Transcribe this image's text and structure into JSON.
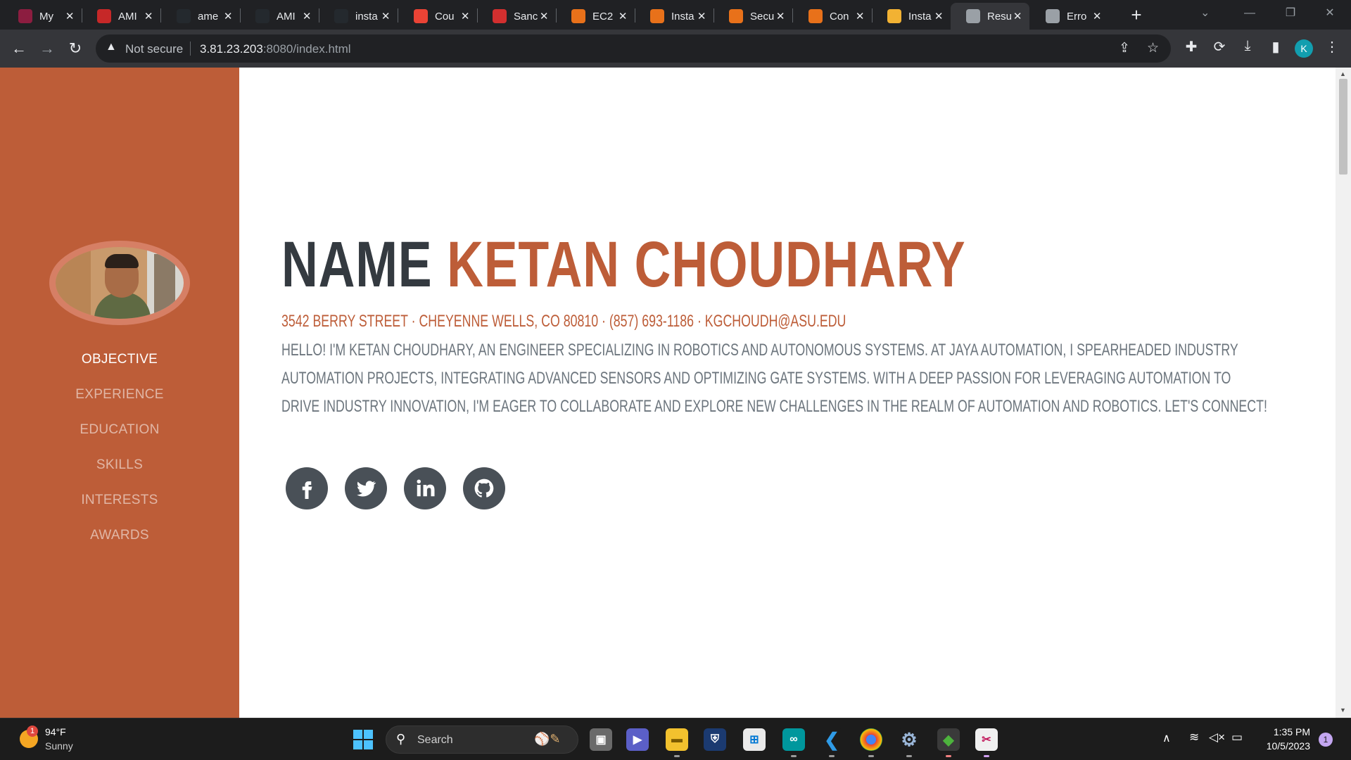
{
  "browser": {
    "tabs": [
      {
        "title": "My",
        "favicon": "asu-icon",
        "color": "#8c1d40"
      },
      {
        "title": "AMI",
        "favicon": "ami-icon",
        "color": "#c62828"
      },
      {
        "title": "ame",
        "favicon": "github-icon",
        "color": "#24292e"
      },
      {
        "title": "AMI",
        "favicon": "github-icon",
        "color": "#24292e"
      },
      {
        "title": "insta",
        "favicon": "github-icon",
        "color": "#24292e"
      },
      {
        "title": "Cou",
        "favicon": "gmail-icon",
        "color": "#ea4335"
      },
      {
        "title": "Sanc",
        "favicon": "sanctuary-icon",
        "color": "#d32f2f"
      },
      {
        "title": "EC2",
        "favicon": "aws-icon",
        "color": "#e8711a"
      },
      {
        "title": "Insta",
        "favicon": "aws-icon",
        "color": "#e8711a"
      },
      {
        "title": "Secu",
        "favicon": "aws-icon",
        "color": "#e8711a"
      },
      {
        "title": "Con",
        "favicon": "aws-icon",
        "color": "#e8711a"
      },
      {
        "title": "Insta",
        "favicon": "package-icon",
        "color": "#f2b233"
      },
      {
        "title": "Resu",
        "favicon": "globe-icon",
        "color": "#9aa0a6",
        "active": true
      },
      {
        "title": "Erro",
        "favicon": "globe-icon",
        "color": "#9aa0a6"
      }
    ],
    "close_glyph": "✕",
    "new_tab_glyph": "+",
    "security_label": "Not secure",
    "url_host": "3.81.23.203",
    "url_rest": ":8080/index.html",
    "profile_initial": "K"
  },
  "page": {
    "sidebar": {
      "nav": [
        {
          "label": "OBJECTIVE",
          "active": true
        },
        {
          "label": "EXPERIENCE"
        },
        {
          "label": "EDUCATION"
        },
        {
          "label": "SKILLS"
        },
        {
          "label": "INTERESTS"
        },
        {
          "label": "AWARDS"
        }
      ],
      "color": "#bd5d38"
    },
    "heading_first": "NAME",
    "heading_last": "KETAN CHOUDHARY",
    "contact": "3542 BERRY STREET · CHEYENNE WELLS, CO 80810 · (857) 693-1186 · KGCHOUDH@ASU.EDU",
    "bio": "HELLO! I'M KETAN CHOUDHARY, AN ENGINEER SPECIALIZING IN ROBOTICS AND AUTONOMOUS SYSTEMS. AT JAYA AUTOMATION, I SPEARHEADED INDUSTRY AUTOMATION PROJECTS, INTEGRATING ADVANCED SENSORS AND OPTIMIZING GATE SYSTEMS. WITH A DEEP PASSION FOR LEVERAGING AUTOMATION TO DRIVE INDUSTRY INNOVATION, I'M EAGER TO COLLABORATE AND EXPLORE NEW CHALLENGES IN THE REALM OF AUTOMATION AND ROBOTICS. LET'S CONNECT!",
    "social": [
      "facebook-icon",
      "twitter-icon",
      "linkedin-icon",
      "github-icon"
    ],
    "accent_color": "#bd5d38",
    "heading_color": "#343a40",
    "text_color": "#6c757d"
  },
  "taskbar": {
    "weather_temp": "94°F",
    "weather_cond": "Sunny",
    "weather_badge": "1",
    "search_label": "Search",
    "apps": [
      "file-explorer-icon",
      "teams-icon",
      "folder-icon",
      "vpn-icon",
      "store-icon",
      "arduino-icon",
      "vscode-icon",
      "chrome-icon",
      "settings-icon",
      "mongodb-icon",
      "snipping-tool-icon"
    ],
    "time": "1:35 PM",
    "date": "10/5/2023",
    "notification_count": "1"
  }
}
